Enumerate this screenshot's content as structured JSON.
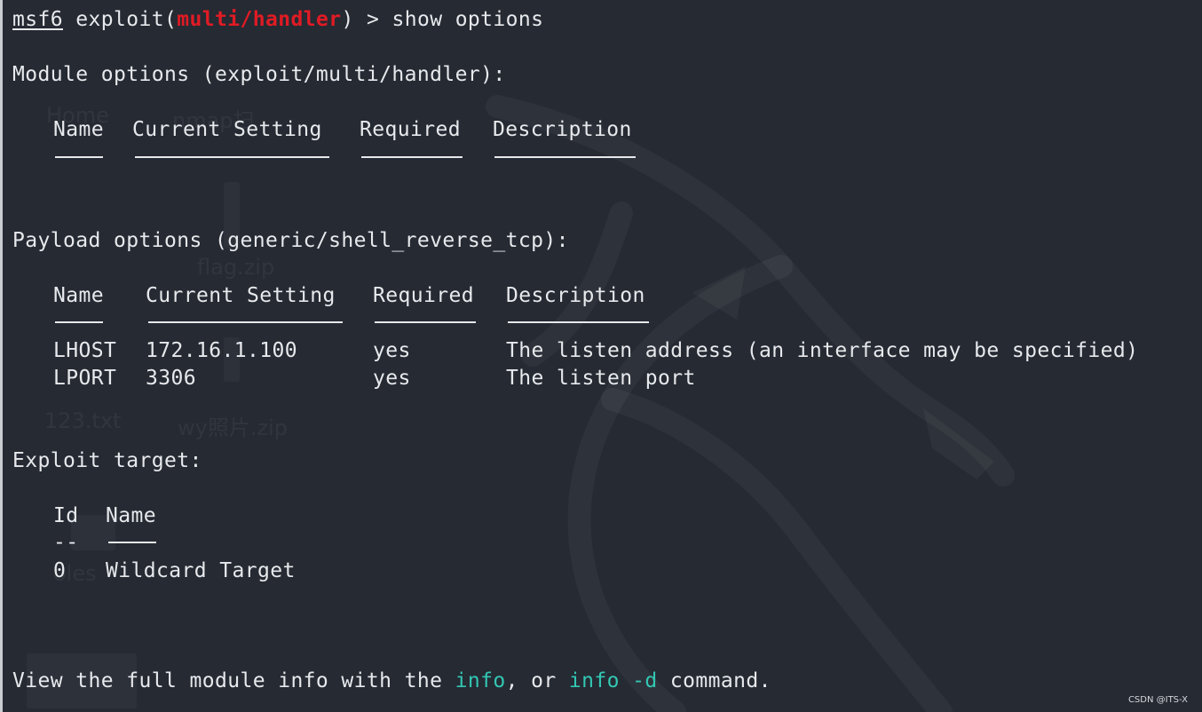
{
  "prompt": {
    "user": "msf6",
    "context_prefix": " exploit(",
    "module": "multi/handler",
    "context_suffix": ") > ",
    "command": "show options"
  },
  "module_options": {
    "heading": "Module options (exploit/multi/handler):",
    "columns": [
      "Name",
      "Current Setting",
      "Required",
      "Description"
    ]
  },
  "payload_options": {
    "heading": "Payload options (generic/shell_reverse_tcp):",
    "columns": [
      "Name",
      "Current Setting",
      "Required",
      "Description"
    ],
    "rows": [
      {
        "name": "LHOST",
        "setting": "172.16.1.100",
        "required": "yes",
        "description": "The listen address (an interface may be specified)"
      },
      {
        "name": "LPORT",
        "setting": "3306",
        "required": "yes",
        "description": "The listen port"
      }
    ]
  },
  "exploit_target": {
    "heading": "Exploit target:",
    "columns": [
      "Id",
      "Name"
    ],
    "id_rule": "--",
    "rows": [
      {
        "id": "0",
        "name": "Wildcard Target"
      }
    ]
  },
  "footer": {
    "prefix": "View the full module info with the ",
    "cmd1": "info",
    "middle": ", or ",
    "cmd2": "info -d",
    "suffix": " command."
  },
  "background_ghosts": {
    "desktop_items": [
      "Home",
      "nmap扫",
      "flag.zip",
      "123.txt",
      "wy照片.zip",
      "oles"
    ]
  },
  "watermark": "CSDN @ITS-X",
  "colors": {
    "background": "#252a33",
    "text": "#e7e9ec",
    "module_name": "#e01b24",
    "command_highlight": "#33c7b3"
  }
}
